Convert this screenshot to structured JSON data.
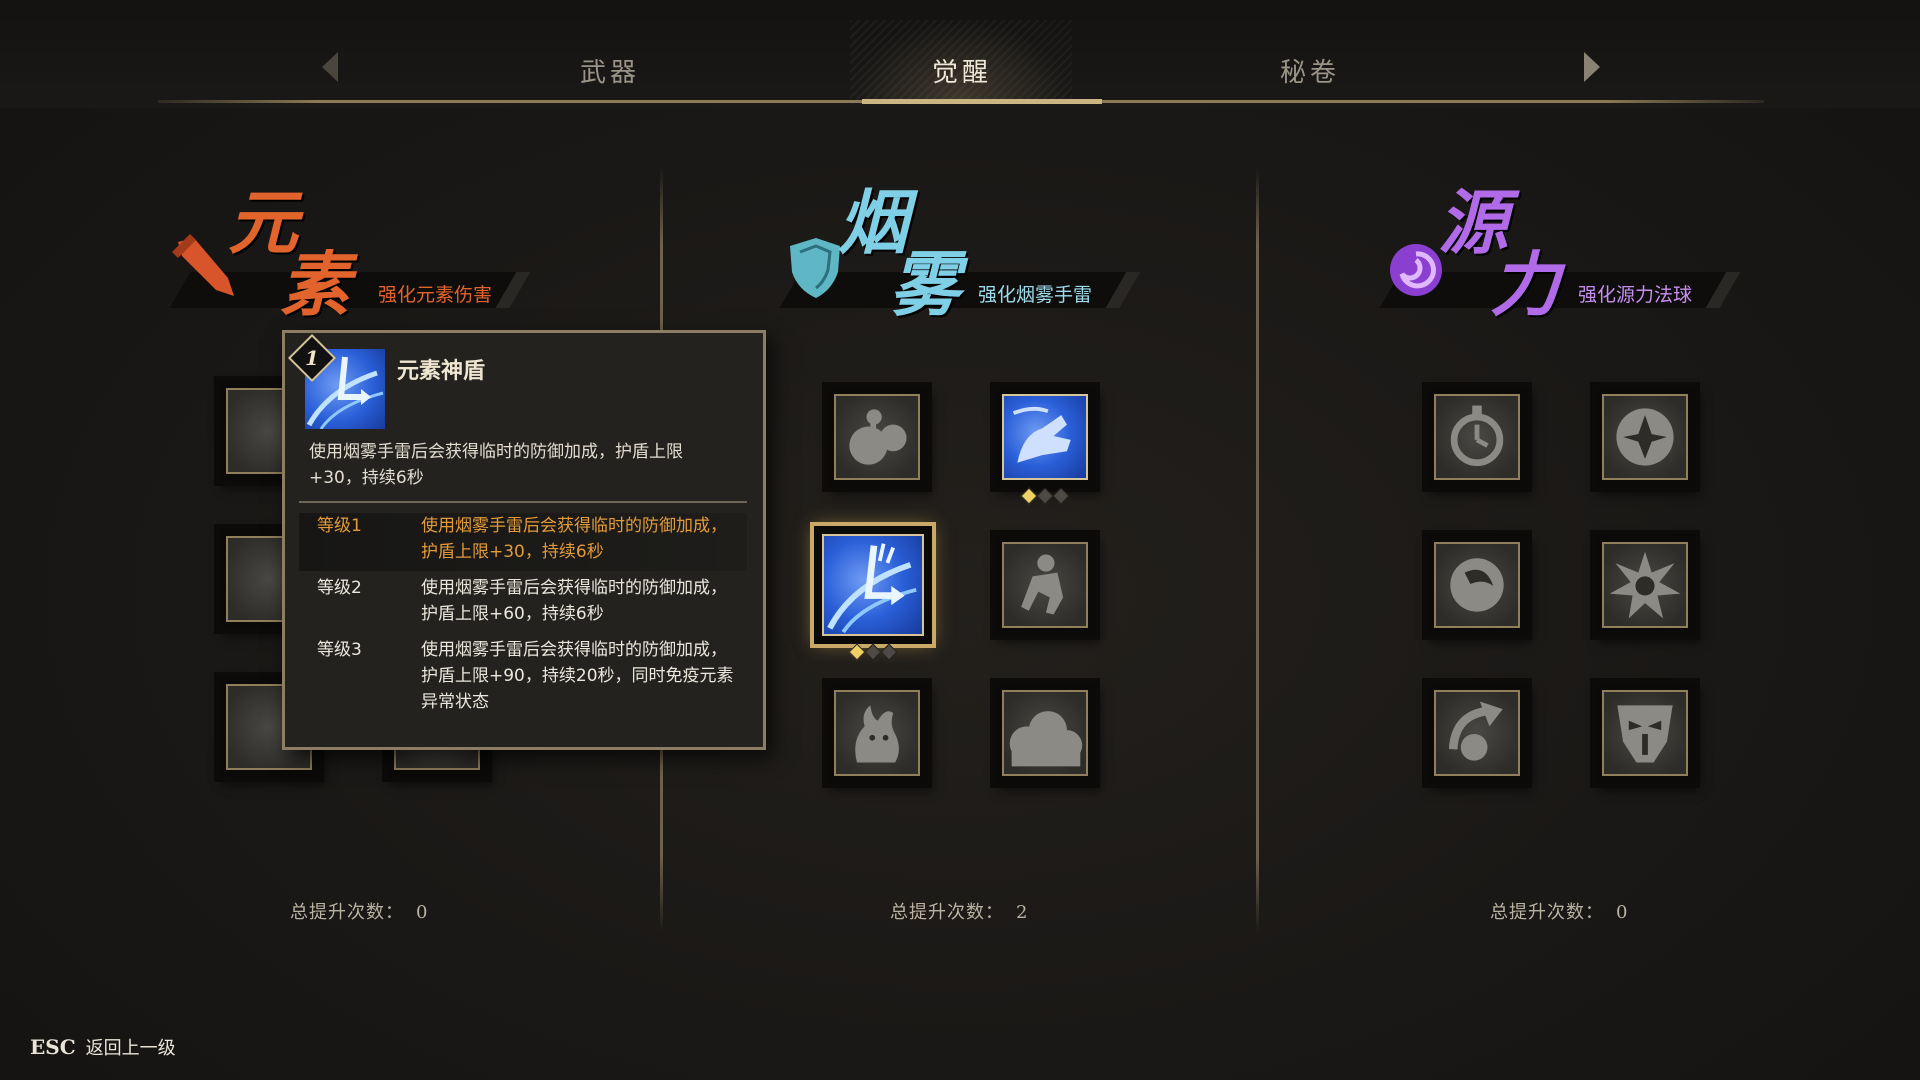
{
  "tabs": [
    {
      "label": "武器",
      "active": false
    },
    {
      "label": "觉醒",
      "active": true
    },
    {
      "label": "秘卷",
      "active": false
    }
  ],
  "categories": [
    {
      "id": "element",
      "title_chars": [
        "元",
        "素"
      ],
      "subtitle": "强化元素伤害",
      "color": "#e2632b",
      "emblem": "sword-icon",
      "total_label": "总提升次数：",
      "total_value": "0"
    },
    {
      "id": "smoke",
      "title_chars": [
        "烟",
        "雾"
      ],
      "subtitle": "强化烟雾手雷",
      "color": "#7fd0e6",
      "emblem": "shield-icon",
      "total_label": "总提升次数：",
      "total_value": "2"
    },
    {
      "id": "source",
      "title_chars": [
        "源",
        "力"
      ],
      "subtitle": "强化源力法球",
      "color": "#b26be8",
      "emblem": "swirl-icon",
      "total_label": "总提升次数：",
      "total_value": "0"
    }
  ],
  "smoke_slots": [
    {
      "icon": "bomb-icon",
      "active": false
    },
    {
      "icon": "hand-icon",
      "active": true,
      "level": 1,
      "max_level": 3
    },
    {
      "icon": "shield-shatter-icon",
      "active": true,
      "level": 1,
      "max_level": 3,
      "selected": true
    },
    {
      "icon": "crouch-figure-icon",
      "active": false
    },
    {
      "icon": "demon-icon",
      "active": false
    },
    {
      "icon": "smoke-cloud-icon",
      "active": false
    }
  ],
  "source_slots": [
    {
      "icon": "stopwatch-icon",
      "active": false
    },
    {
      "icon": "shuriken-icon",
      "active": false
    },
    {
      "icon": "orb-icon",
      "active": false
    },
    {
      "icon": "spiky-burst-icon",
      "active": false
    },
    {
      "icon": "arrow-swirl-icon",
      "active": false
    },
    {
      "icon": "mask-icon",
      "active": false
    }
  ],
  "tooltip": {
    "badge": "1",
    "name": "元素神盾",
    "description": "使用烟雾手雷后会获得临时的防御加成，护盾上限+30，持续6秒",
    "levels": [
      {
        "label": "等级1",
        "text": "使用烟雾手雷后会获得临时的防御加成，护盾上限+30，持续6秒",
        "current": true
      },
      {
        "label": "等级2",
        "text": "使用烟雾手雷后会获得临时的防御加成，护盾上限+60，持续6秒",
        "current": false
      },
      {
        "label": "等级3",
        "text": "使用烟雾手雷后会获得临时的防御加成，护盾上限+90，持续20秒，同时免疫元素异常状态",
        "current": false
      }
    ]
  },
  "footer": {
    "key": "ESC",
    "label": "返回上一级"
  }
}
